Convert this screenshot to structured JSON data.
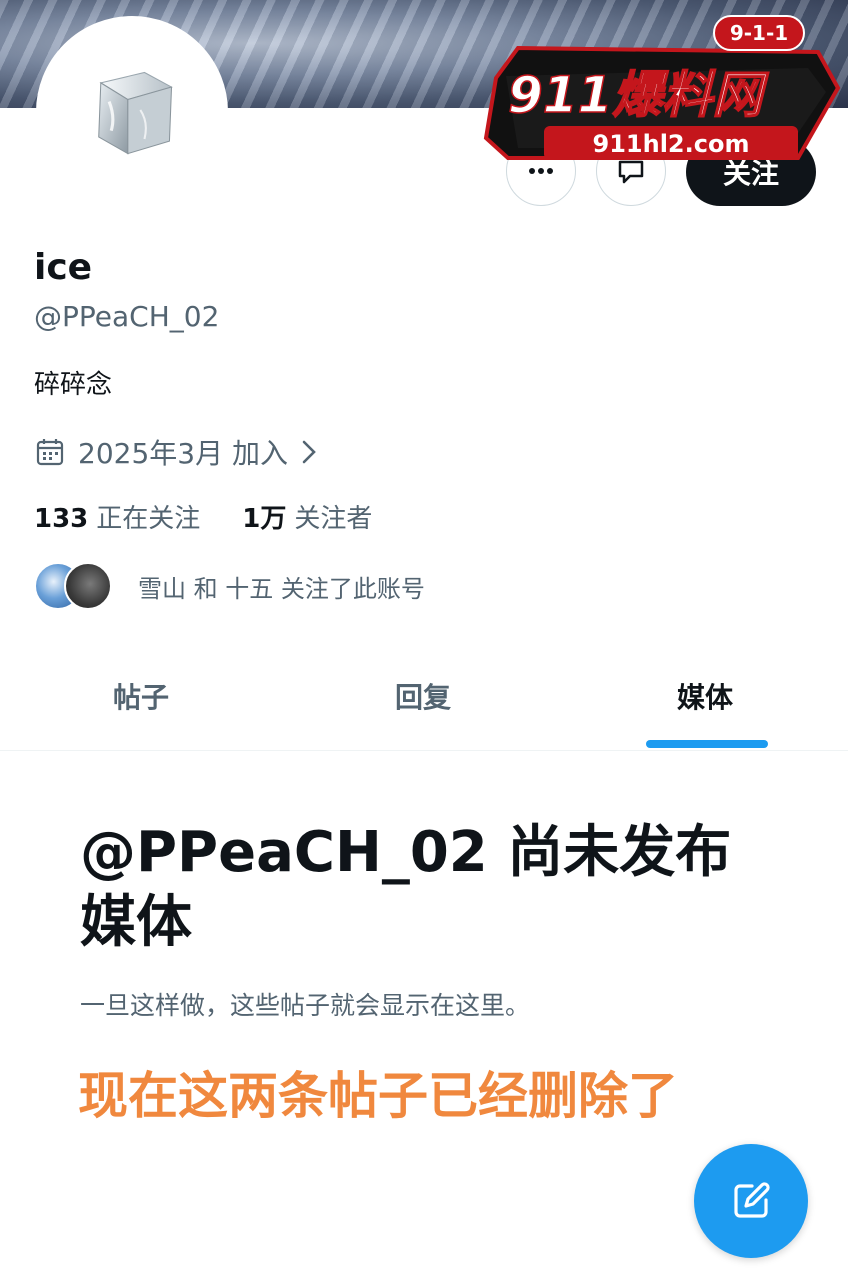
{
  "profile": {
    "name": "ice",
    "handle": "@PPeaCH_02",
    "bio": "碎碎念",
    "joined": "2025年3月 加入",
    "following_count": "133",
    "following_label": "正在关注",
    "followers_count": "1万",
    "followers_label": "关注者",
    "followed_by": "雪山 和 十五 关注了此账号"
  },
  "actions": {
    "follow_label": "关注",
    "more_icon": "more-icon",
    "message_icon": "message-icon"
  },
  "tabs": [
    {
      "label": "帖子",
      "active": false
    },
    {
      "label": "回复",
      "active": false
    },
    {
      "label": "媒体",
      "active": true
    }
  ],
  "empty_state": {
    "title": "@PPeaCH_02 尚未发布媒体",
    "subtitle": "一旦这样做，这些帖子就会显示在这里。"
  },
  "overlay_note": "现在这两条帖子已经删除了",
  "watermark": {
    "badge": "9-1-1",
    "brand": "911爆料网",
    "site": "911hl2.com"
  },
  "colors": {
    "accent": "#1d9bf0",
    "note": "#f0883e",
    "follow_button": "#0f1419"
  }
}
